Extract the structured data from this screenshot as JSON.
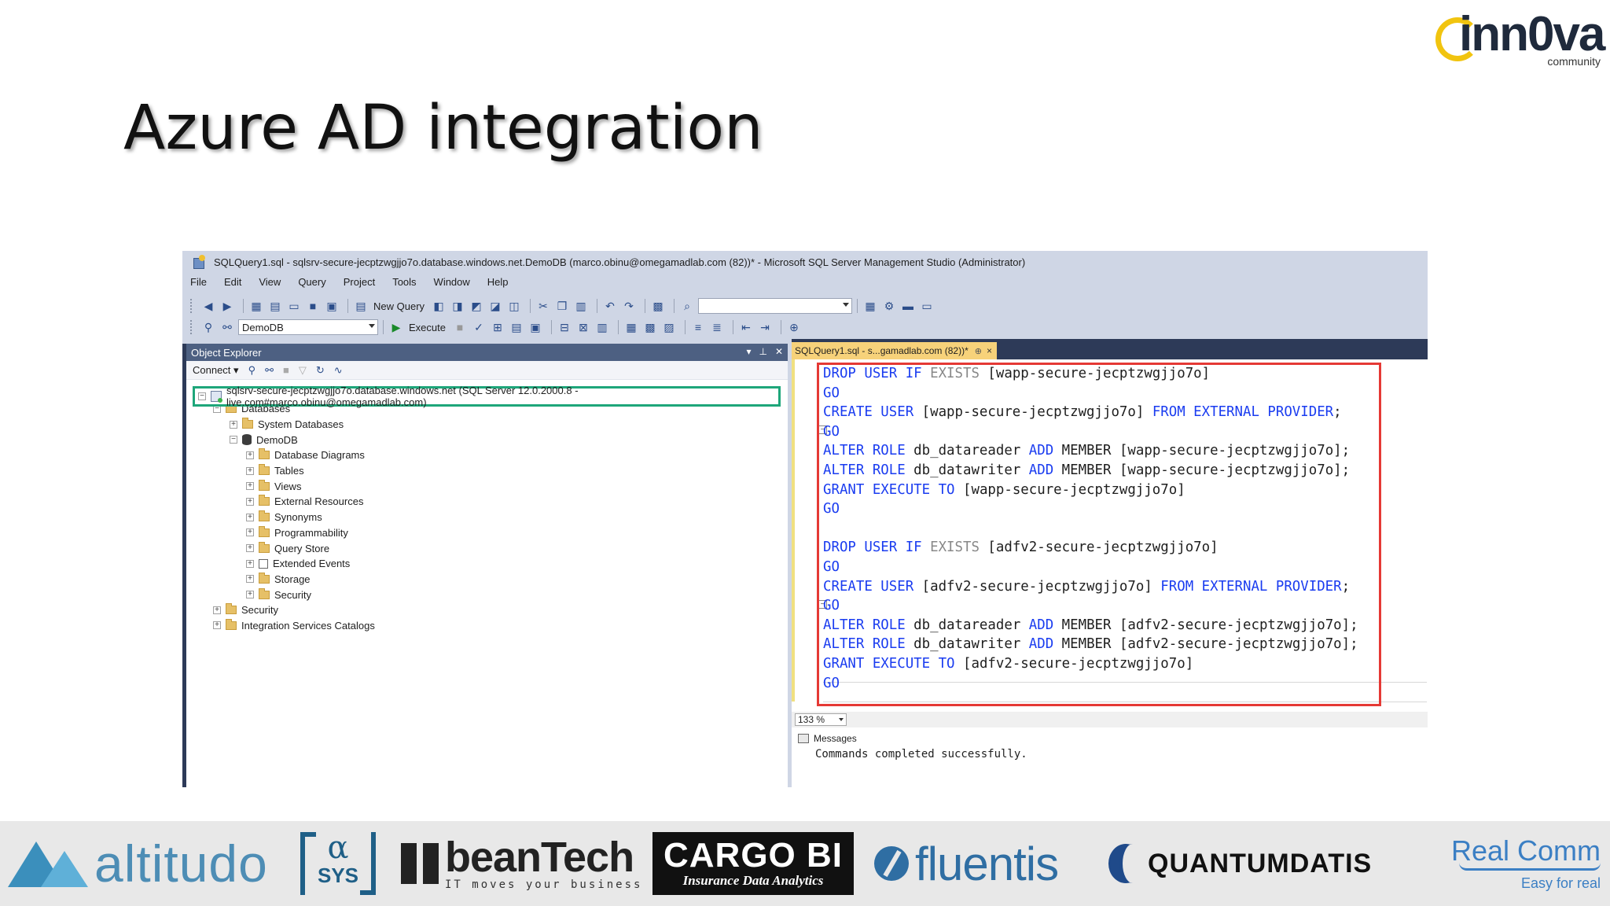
{
  "slide": {
    "title": "Azure AD integration",
    "brand": {
      "name": "inn0va",
      "sub": "community"
    }
  },
  "ssms": {
    "window_title": "SQLQuery1.sql - sqlsrv-secure-jecptzwgjjo7o.database.windows.net.DemoDB (marco.obinu@omegamadlab.com (82))* - Microsoft SQL Server Management Studio (Administrator)",
    "menu": [
      "File",
      "Edit",
      "View",
      "Query",
      "Project",
      "Tools",
      "Window",
      "Help"
    ],
    "toolbar1": {
      "new_query": "New Query"
    },
    "toolbar2": {
      "database": "DemoDB",
      "execute": "Execute"
    },
    "object_explorer": {
      "title": "Object Explorer",
      "connect": "Connect",
      "server": "sqlsrv-secure-jecptzwgjjo7o.database.windows.net (SQL Server 12.0.2000.8 - live.com#marco.obinu@omegamadlab.com)",
      "databases": "Databases",
      "system_databases": "System Databases",
      "demo_db": "DemoDB",
      "db_children": [
        "Database Diagrams",
        "Tables",
        "Views",
        "External Resources",
        "Synonyms",
        "Programmability",
        "Query Store",
        "Extended Events",
        "Storage",
        "Security"
      ],
      "security": "Security",
      "integration": "Integration Services Catalogs"
    },
    "editor": {
      "tab_label": "SQLQuery1.sql - s...gamadlab.com (82))*",
      "tab_pin": "⊕",
      "tab_close": "×",
      "code": [
        {
          "k1": "DROP USER IF",
          "g": " EXISTS",
          "r": " [wapp-secure-jecptzwgjjo7o]"
        },
        {
          "k1": "GO",
          "g": "",
          "r": ""
        },
        {
          "k1": "CREATE USER",
          "g": "",
          "r": " [wapp-secure-jecptzwgjjo7o] ",
          "k2": "FROM EXTERNAL PROVIDER",
          "e": ";"
        },
        {
          "k1": "GO",
          "g": "",
          "r": ""
        },
        {
          "k1": "ALTER ROLE",
          "g": "",
          "r": " db_datareader ",
          "k2": "ADD",
          "e": " MEMBER [wapp-secure-jecptzwgjjo7o];"
        },
        {
          "k1": "ALTER ROLE",
          "g": "",
          "r": " db_datawriter ",
          "k2": "ADD",
          "e": " MEMBER [wapp-secure-jecptzwgjjo7o];"
        },
        {
          "k1": "GRANT EXECUTE TO",
          "g": "",
          "r": " [wapp-secure-jecptzwgjjo7o]"
        },
        {
          "k1": "GO",
          "g": "",
          "r": ""
        },
        {
          "k1": "",
          "g": "",
          "r": ""
        },
        {
          "k1": "DROP USER IF",
          "g": " EXISTS",
          "r": " [adfv2-secure-jecptzwgjjo7o]"
        },
        {
          "k1": "GO",
          "g": "",
          "r": ""
        },
        {
          "k1": "CREATE USER",
          "g": "",
          "r": " [adfv2-secure-jecptzwgjjo7o] ",
          "k2": "FROM EXTERNAL PROVIDER",
          "e": ";"
        },
        {
          "k1": "GO",
          "g": "",
          "r": ""
        },
        {
          "k1": "ALTER ROLE",
          "g": "",
          "r": " db_datareader ",
          "k2": "ADD",
          "e": " MEMBER [adfv2-secure-jecptzwgjjo7o];"
        },
        {
          "k1": "ALTER ROLE",
          "g": "",
          "r": " db_datawriter ",
          "k2": "ADD",
          "e": " MEMBER [adfv2-secure-jecptzwgjjo7o];"
        },
        {
          "k1": "GRANT EXECUTE TO",
          "g": "",
          "r": " [adfv2-secure-jecptzwgjjo7o]"
        },
        {
          "k1": "GO",
          "g": "",
          "r": ""
        }
      ],
      "zoom": "133 %",
      "messages_tab": "Messages",
      "result_message": "Commands completed successfully."
    }
  },
  "sponsors": {
    "altitudo": "altitudo",
    "asys_alpha": "α",
    "asys_sys": "SYS",
    "beantech": "beanTech",
    "beantech_tag": "IT moves your business",
    "cargobi": "CARGO BI",
    "cargobi_tag": "Insurance Data Analytics",
    "fluentis": "fluentis",
    "quantumdatis": "QUANTUMDATIS",
    "realcomm": "Real Comm",
    "realcomm_tag": "Easy for real"
  },
  "colors": {
    "keyword": "#1a3cf0",
    "keyword_gray": "#888888",
    "highlight_green": "#1ea67a",
    "highlight_red": "#e53935",
    "tab_yellow": "#f7d27a",
    "panel_dark": "#2d3a58"
  }
}
